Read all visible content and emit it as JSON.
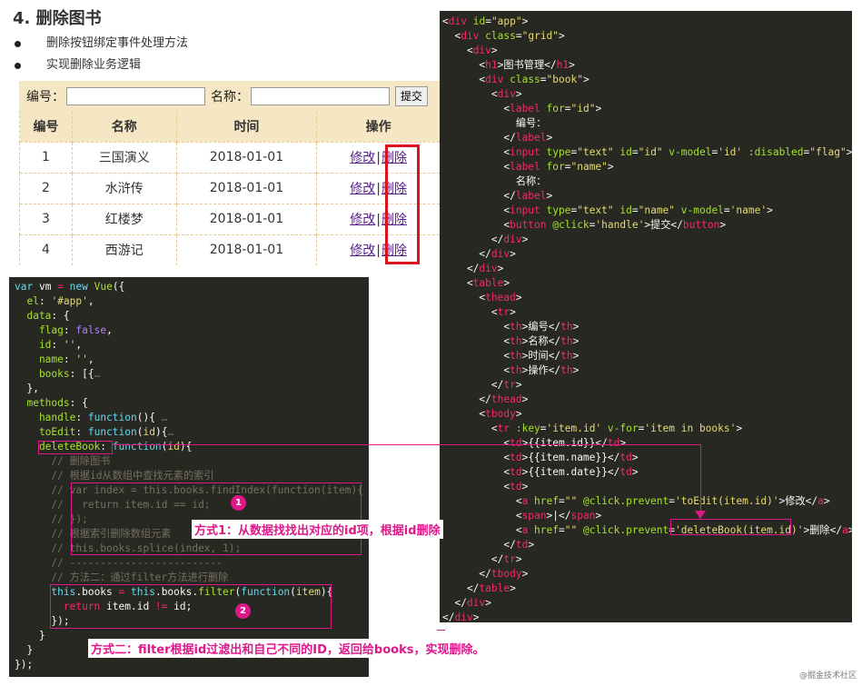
{
  "doc": {
    "title": "4. 删除图书",
    "bullets": [
      "删除按钮绑定事件处理方法",
      "实现删除业务逻辑"
    ]
  },
  "demo": {
    "id_label": "编号：",
    "name_label": "名称：",
    "submit_label": "提交",
    "headers": [
      "编号",
      "名称",
      "时间",
      "操作"
    ],
    "rows": [
      {
        "id": "1",
        "name": "三国演义",
        "date": "2018-01-01"
      },
      {
        "id": "2",
        "name": "水浒传",
        "date": "2018-01-01"
      },
      {
        "id": "3",
        "name": "红楼梦",
        "date": "2018-01-01"
      },
      {
        "id": "4",
        "name": "西游记",
        "date": "2018-01-01"
      }
    ],
    "edit_label": "修改",
    "separator": "|",
    "delete_label": "删除"
  },
  "annotations": {
    "badge1": "1",
    "badge2": "2",
    "note1": "方式1：从数据找找出对应的id项，根据id删除",
    "note2": "方式二：filter根据id过滤出和自己不同的ID，返回给books，实现删除。"
  },
  "watermark": "@掘金技术社区",
  "js_code": [
    [
      [
        "var",
        "c-kw"
      ],
      [
        " vm ",
        "c-plain"
      ],
      [
        "=",
        "c-tag"
      ],
      [
        " new ",
        "c-kw"
      ],
      [
        "Vue",
        "c-fn"
      ],
      [
        "({",
        "c-plain"
      ]
    ],
    [
      [
        "  el",
        "c-prop"
      ],
      [
        ": ",
        "c-plain"
      ],
      [
        "'#app'",
        "c-str"
      ],
      [
        ",",
        "c-plain"
      ]
    ],
    [
      [
        "  data",
        "c-prop"
      ],
      [
        ": {",
        "c-plain"
      ]
    ],
    [
      [
        "    flag",
        "c-prop"
      ],
      [
        ": ",
        "c-plain"
      ],
      [
        "false",
        "c-num"
      ],
      [
        ",",
        "c-plain"
      ]
    ],
    [
      [
        "    id",
        "c-prop"
      ],
      [
        ": ",
        "c-plain"
      ],
      [
        "''",
        "c-str"
      ],
      [
        ",",
        "c-plain"
      ]
    ],
    [
      [
        "    name",
        "c-prop"
      ],
      [
        ": ",
        "c-plain"
      ],
      [
        "''",
        "c-str"
      ],
      [
        ",",
        "c-plain"
      ]
    ],
    [
      [
        "    books",
        "c-prop"
      ],
      [
        ": [{",
        "c-plain"
      ],
      [
        "…",
        "c-cm"
      ]
    ],
    [
      [
        "  },",
        "c-plain"
      ]
    ],
    [
      [
        "  methods",
        "c-prop"
      ],
      [
        ": {",
        "c-plain"
      ]
    ],
    [
      [
        "    handle",
        "c-prop"
      ],
      [
        ": ",
        "c-plain"
      ],
      [
        "function",
        "c-kw"
      ],
      [
        "(){",
        "c-plain"
      ],
      [
        " …",
        "c-cm"
      ]
    ],
    [
      [
        "    toEdit",
        "c-prop"
      ],
      [
        ": ",
        "c-plain"
      ],
      [
        "function",
        "c-kw"
      ],
      [
        "(",
        "c-plain"
      ],
      [
        "id",
        "c-str"
      ],
      [
        "){",
        "c-plain"
      ],
      [
        "…",
        "c-cm"
      ]
    ],
    [
      [
        "    deleteBook",
        "c-prop"
      ],
      [
        ": ",
        "c-plain"
      ],
      [
        "function",
        "c-kw"
      ],
      [
        "(",
        "c-plain"
      ],
      [
        "id",
        "c-str"
      ],
      [
        "){",
        "c-plain"
      ]
    ],
    [
      [
        "      // 删除图书",
        "c-cm"
      ]
    ],
    [
      [
        "      // 根据id从数组中查找元素的索引",
        "c-cm"
      ]
    ],
    [
      [
        "      // var index = this.books.findIndex(function(item){",
        "c-cm"
      ]
    ],
    [
      [
        "      //   return item.id == id;",
        "c-cm"
      ]
    ],
    [
      [
        "      // });",
        "c-cm"
      ]
    ],
    [
      [
        "      // 根据索引删除数组元素",
        "c-cm"
      ]
    ],
    [
      [
        "      // this.books.splice(index, 1);",
        "c-cm"
      ]
    ],
    [
      [
        "      // -------------------------",
        "c-cm"
      ]
    ],
    [
      [
        "      // 方法二：通过filter方法进行删除",
        "c-cm"
      ]
    ],
    [
      [
        "      this",
        "c-kw"
      ],
      [
        ".books ",
        "c-plain"
      ],
      [
        "=",
        "c-tag"
      ],
      [
        " this",
        "c-kw"
      ],
      [
        ".books.",
        "c-plain"
      ],
      [
        "filter",
        "c-fn"
      ],
      [
        "(",
        "c-plain"
      ],
      [
        "function",
        "c-kw"
      ],
      [
        "(",
        "c-plain"
      ],
      [
        "item",
        "c-str"
      ],
      [
        "){",
        "c-plain"
      ]
    ],
    [
      [
        "        return",
        "c-tag"
      ],
      [
        " item.id ",
        "c-plain"
      ],
      [
        "!=",
        "c-tag"
      ],
      [
        " id;",
        "c-plain"
      ]
    ],
    [
      [
        "      });",
        "c-plain"
      ]
    ],
    [
      [
        "    }",
        "c-plain"
      ]
    ],
    [
      [
        "  }",
        "c-plain"
      ]
    ],
    [
      [
        "});",
        "c-plain"
      ]
    ]
  ],
  "html_code": [
    [
      [
        "<",
        "c-plain"
      ],
      [
        "div",
        "c-tag"
      ],
      [
        " id",
        "c-attr"
      ],
      [
        "=",
        "c-plain"
      ],
      [
        "\"app\"",
        "c-str"
      ],
      [
        ">",
        "c-plain"
      ]
    ],
    [
      [
        "  <",
        "c-plain"
      ],
      [
        "div",
        "c-tag"
      ],
      [
        " class",
        "c-attr"
      ],
      [
        "=",
        "c-plain"
      ],
      [
        "\"grid\"",
        "c-str"
      ],
      [
        ">",
        "c-plain"
      ]
    ],
    [
      [
        "    <",
        "c-plain"
      ],
      [
        "div",
        "c-tag"
      ],
      [
        ">",
        "c-plain"
      ]
    ],
    [
      [
        "      <",
        "c-plain"
      ],
      [
        "h1",
        "c-tag"
      ],
      [
        ">图书管理</",
        "c-plain"
      ],
      [
        "h1",
        "c-tag"
      ],
      [
        ">",
        "c-plain"
      ]
    ],
    [
      [
        "      <",
        "c-plain"
      ],
      [
        "div",
        "c-tag"
      ],
      [
        " class",
        "c-attr"
      ],
      [
        "=",
        "c-plain"
      ],
      [
        "\"book\"",
        "c-str"
      ],
      [
        ">",
        "c-plain"
      ]
    ],
    [
      [
        "        <",
        "c-plain"
      ],
      [
        "div",
        "c-tag"
      ],
      [
        ">",
        "c-plain"
      ]
    ],
    [
      [
        "          <",
        "c-plain"
      ],
      [
        "label",
        "c-tag"
      ],
      [
        " for",
        "c-attr"
      ],
      [
        "=",
        "c-plain"
      ],
      [
        "\"id\"",
        "c-str"
      ],
      [
        ">",
        "c-plain"
      ]
    ],
    [
      [
        "            编号：",
        "c-plain"
      ]
    ],
    [
      [
        "          </",
        "c-plain"
      ],
      [
        "label",
        "c-tag"
      ],
      [
        ">",
        "c-plain"
      ]
    ],
    [
      [
        "          <",
        "c-plain"
      ],
      [
        "input",
        "c-tag"
      ],
      [
        " type",
        "c-attr"
      ],
      [
        "=",
        "c-plain"
      ],
      [
        "\"text\"",
        "c-str"
      ],
      [
        " id",
        "c-attr"
      ],
      [
        "=",
        "c-plain"
      ],
      [
        "\"id\"",
        "c-str"
      ],
      [
        " v-model",
        "c-attr"
      ],
      [
        "=",
        "c-plain"
      ],
      [
        "'id'",
        "c-str"
      ],
      [
        " :disabled",
        "c-attr"
      ],
      [
        "=",
        "c-plain"
      ],
      [
        "\"flag\"",
        "c-str"
      ],
      [
        ">",
        "c-plain"
      ]
    ],
    [
      [
        "          <",
        "c-plain"
      ],
      [
        "label",
        "c-tag"
      ],
      [
        " for",
        "c-attr"
      ],
      [
        "=",
        "c-plain"
      ],
      [
        "\"name\"",
        "c-str"
      ],
      [
        ">",
        "c-plain"
      ]
    ],
    [
      [
        "            名称：",
        "c-plain"
      ]
    ],
    [
      [
        "          </",
        "c-plain"
      ],
      [
        "label",
        "c-tag"
      ],
      [
        ">",
        "c-plain"
      ]
    ],
    [
      [
        "          <",
        "c-plain"
      ],
      [
        "input",
        "c-tag"
      ],
      [
        " type",
        "c-attr"
      ],
      [
        "=",
        "c-plain"
      ],
      [
        "\"text\"",
        "c-str"
      ],
      [
        " id",
        "c-attr"
      ],
      [
        "=",
        "c-plain"
      ],
      [
        "\"name\"",
        "c-str"
      ],
      [
        " v-model",
        "c-attr"
      ],
      [
        "=",
        "c-plain"
      ],
      [
        "'name'",
        "c-str"
      ],
      [
        ">",
        "c-plain"
      ]
    ],
    [
      [
        "          <",
        "c-plain"
      ],
      [
        "button",
        "c-tag"
      ],
      [
        " @click",
        "c-attr"
      ],
      [
        "=",
        "c-plain"
      ],
      [
        "'handle'",
        "c-str"
      ],
      [
        ">提交</",
        "c-plain"
      ],
      [
        "button",
        "c-tag"
      ],
      [
        ">",
        "c-plain"
      ]
    ],
    [
      [
        "        </",
        "c-plain"
      ],
      [
        "div",
        "c-tag"
      ],
      [
        ">",
        "c-plain"
      ]
    ],
    [
      [
        "      </",
        "c-plain"
      ],
      [
        "div",
        "c-tag"
      ],
      [
        ">",
        "c-plain"
      ]
    ],
    [
      [
        "    </",
        "c-plain"
      ],
      [
        "div",
        "c-tag"
      ],
      [
        ">",
        "c-plain"
      ]
    ],
    [
      [
        "    <",
        "c-plain"
      ],
      [
        "table",
        "c-tag"
      ],
      [
        ">",
        "c-plain"
      ]
    ],
    [
      [
        "      <",
        "c-plain"
      ],
      [
        "thead",
        "c-tag"
      ],
      [
        ">",
        "c-plain"
      ]
    ],
    [
      [
        "        <",
        "c-plain"
      ],
      [
        "tr",
        "c-tag"
      ],
      [
        ">",
        "c-plain"
      ]
    ],
    [
      [
        "          <",
        "c-plain"
      ],
      [
        "th",
        "c-tag"
      ],
      [
        ">编号</",
        "c-plain"
      ],
      [
        "th",
        "c-tag"
      ],
      [
        ">",
        "c-plain"
      ]
    ],
    [
      [
        "          <",
        "c-plain"
      ],
      [
        "th",
        "c-tag"
      ],
      [
        ">名称</",
        "c-plain"
      ],
      [
        "th",
        "c-tag"
      ],
      [
        ">",
        "c-plain"
      ]
    ],
    [
      [
        "          <",
        "c-plain"
      ],
      [
        "th",
        "c-tag"
      ],
      [
        ">时间</",
        "c-plain"
      ],
      [
        "th",
        "c-tag"
      ],
      [
        ">",
        "c-plain"
      ]
    ],
    [
      [
        "          <",
        "c-plain"
      ],
      [
        "th",
        "c-tag"
      ],
      [
        ">操作</",
        "c-plain"
      ],
      [
        "th",
        "c-tag"
      ],
      [
        ">",
        "c-plain"
      ]
    ],
    [
      [
        "        </",
        "c-plain"
      ],
      [
        "tr",
        "c-tag"
      ],
      [
        ">",
        "c-plain"
      ]
    ],
    [
      [
        "      </",
        "c-plain"
      ],
      [
        "thead",
        "c-tag"
      ],
      [
        ">",
        "c-plain"
      ]
    ],
    [
      [
        "      <",
        "c-plain"
      ],
      [
        "tbody",
        "c-tag"
      ],
      [
        ">",
        "c-plain"
      ]
    ],
    [
      [
        "        <",
        "c-plain"
      ],
      [
        "tr",
        "c-tag"
      ],
      [
        " :key",
        "c-attr"
      ],
      [
        "=",
        "c-plain"
      ],
      [
        "'item.id'",
        "c-str"
      ],
      [
        " v-for",
        "c-attr"
      ],
      [
        "=",
        "c-plain"
      ],
      [
        "'item in books'",
        "c-str"
      ],
      [
        ">",
        "c-plain"
      ]
    ],
    [
      [
        "          <",
        "c-plain"
      ],
      [
        "td",
        "c-tag"
      ],
      [
        ">{{item.id}}</",
        "c-plain"
      ],
      [
        "td",
        "c-tag"
      ],
      [
        ">",
        "c-plain"
      ]
    ],
    [
      [
        "          <",
        "c-plain"
      ],
      [
        "td",
        "c-tag"
      ],
      [
        ">{{item.name}}</",
        "c-plain"
      ],
      [
        "td",
        "c-tag"
      ],
      [
        ">",
        "c-plain"
      ]
    ],
    [
      [
        "          <",
        "c-plain"
      ],
      [
        "td",
        "c-tag"
      ],
      [
        ">{{item.date}}</",
        "c-plain"
      ],
      [
        "td",
        "c-tag"
      ],
      [
        ">",
        "c-plain"
      ]
    ],
    [
      [
        "          <",
        "c-plain"
      ],
      [
        "td",
        "c-tag"
      ],
      [
        ">",
        "c-plain"
      ]
    ],
    [
      [
        "            <",
        "c-plain"
      ],
      [
        "a",
        "c-tag"
      ],
      [
        " href",
        "c-attr"
      ],
      [
        "=",
        "c-plain"
      ],
      [
        "\"\"",
        "c-str"
      ],
      [
        " @click.prevent",
        "c-attr"
      ],
      [
        "=",
        "c-plain"
      ],
      [
        "'toEdit(item.id)'",
        "c-str"
      ],
      [
        ">修改</",
        "c-plain"
      ],
      [
        "a",
        "c-tag"
      ],
      [
        ">",
        "c-plain"
      ]
    ],
    [
      [
        "            <",
        "c-plain"
      ],
      [
        "span",
        "c-tag"
      ],
      [
        ">|</",
        "c-plain"
      ],
      [
        "span",
        "c-tag"
      ],
      [
        ">",
        "c-plain"
      ]
    ],
    [
      [
        "            <",
        "c-plain"
      ],
      [
        "a",
        "c-tag"
      ],
      [
        " href",
        "c-attr"
      ],
      [
        "=",
        "c-plain"
      ],
      [
        "\"\"",
        "c-str"
      ],
      [
        " @click.prevent",
        "c-attr"
      ],
      [
        "=",
        "c-plain"
      ],
      [
        "'deleteBook(item.id)'",
        "c-str"
      ],
      [
        ">删除</",
        "c-plain"
      ],
      [
        "a",
        "c-tag"
      ],
      [
        ">",
        "c-plain"
      ]
    ],
    [
      [
        "          </",
        "c-plain"
      ],
      [
        "td",
        "c-tag"
      ],
      [
        ">",
        "c-plain"
      ]
    ],
    [
      [
        "        </",
        "c-plain"
      ],
      [
        "tr",
        "c-tag"
      ],
      [
        ">",
        "c-plain"
      ]
    ],
    [
      [
        "      </",
        "c-plain"
      ],
      [
        "tbody",
        "c-tag"
      ],
      [
        ">",
        "c-plain"
      ]
    ],
    [
      [
        "    </",
        "c-plain"
      ],
      [
        "table",
        "c-tag"
      ],
      [
        ">",
        "c-plain"
      ]
    ],
    [
      [
        "  </",
        "c-plain"
      ],
      [
        "div",
        "c-tag"
      ],
      [
        ">",
        "c-plain"
      ]
    ],
    [
      [
        "</",
        "c-plain"
      ],
      [
        "div",
        "c-tag"
      ],
      [
        ">",
        "c-plain"
      ]
    ]
  ]
}
